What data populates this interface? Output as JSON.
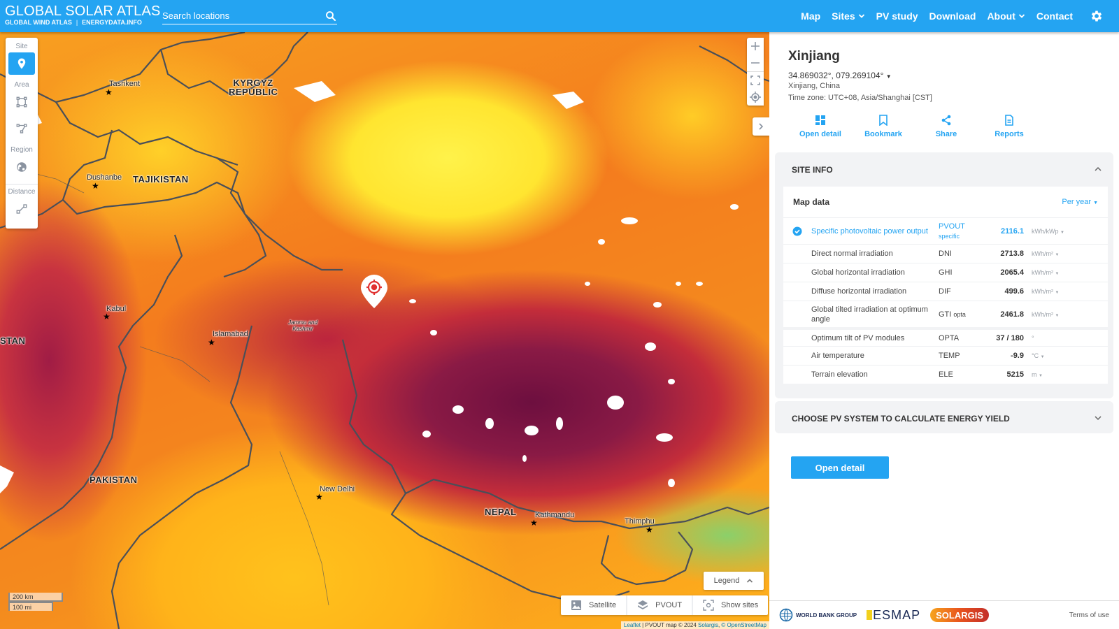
{
  "header": {
    "brand_title": "GLOBAL SOLAR ATLAS",
    "brand_links": [
      "GLOBAL WIND ATLAS",
      "ENERGYDATA.INFO"
    ],
    "search_placeholder": "Search locations",
    "nav": [
      {
        "label": "Map",
        "dropdown": false
      },
      {
        "label": "Sites",
        "dropdown": true
      },
      {
        "label": "PV study",
        "dropdown": false
      },
      {
        "label": "Download",
        "dropdown": false
      },
      {
        "label": "About",
        "dropdown": true
      },
      {
        "label": "Contact",
        "dropdown": false
      }
    ],
    "settings_icon": "gear-icon"
  },
  "toolbox": {
    "site_label": "Site",
    "area_label": "Area",
    "region_label": "Region",
    "distance_label": "Distance"
  },
  "map": {
    "cities": [
      {
        "name": "Tashkent"
      },
      {
        "name": "Dushanbe"
      },
      {
        "name": "Kabul"
      },
      {
        "name": "Islamabad"
      },
      {
        "name": "New Delhi"
      },
      {
        "name": "Kathmandu"
      },
      {
        "name": "Thimphu"
      }
    ],
    "countries": [
      "KYRGYZ REPUBLIC",
      "TAJIKISTAN",
      "PAKISTAN",
      "NEPAL",
      "STAN"
    ],
    "regions": [
      "Jammu and Kashmir"
    ],
    "scale": {
      "km": "200 km",
      "mi": "100 mi"
    },
    "legend_label": "Legend",
    "layers": [
      {
        "label": "Satellite",
        "icon": "image-icon"
      },
      {
        "label": "PVOUT",
        "icon": "layers-icon"
      },
      {
        "label": "Show sites",
        "icon": "scan-icon"
      }
    ],
    "attribution": {
      "leaflet": "Leaflet",
      "text": " | PVOUT map © 2024 ",
      "solargis": "Solargis",
      "osm": "© OpenStreetMap"
    }
  },
  "site": {
    "title": "Xinjiang",
    "coordinates": "34.869032°, 079.269104°",
    "place": "Xinjiang, China",
    "timezone": "Time zone: UTC+08, Asia/Shanghai [CST]",
    "actions": [
      "Open detail",
      "Bookmark",
      "Share",
      "Reports"
    ]
  },
  "site_info": {
    "title": "SITE INFO",
    "map_data_title": "Map data",
    "period": "Per year",
    "rows": [
      {
        "name": "Specific photovoltaic power output",
        "abbr": "PVOUT",
        "abbr_sub": "specific",
        "value": "2116.1",
        "unit": "kWh/kWp",
        "selected": true
      },
      {
        "name": "Direct normal irradiation",
        "abbr": "DNI",
        "abbr_sub": "",
        "value": "2713.8",
        "unit": "kWh/m²"
      },
      {
        "name": "Global horizontal irradiation",
        "abbr": "GHI",
        "abbr_sub": "",
        "value": "2065.4",
        "unit": "kWh/m²"
      },
      {
        "name": "Diffuse horizontal irradiation",
        "abbr": "DIF",
        "abbr_sub": "",
        "value": "499.6",
        "unit": "kWh/m²"
      },
      {
        "name": "Global tilted irradiation at optimum angle",
        "abbr": "GTI",
        "abbr_sub": "opta",
        "value": "2461.8",
        "unit": "kWh/m²"
      },
      {
        "name": "Optimum tilt of PV modules",
        "abbr": "OPTA",
        "abbr_sub": "",
        "value": "37 /  180",
        "unit": "°"
      },
      {
        "name": "Air temperature",
        "abbr": "TEMP",
        "abbr_sub": "",
        "value": "-9.9",
        "unit": "°C"
      },
      {
        "name": "Terrain elevation",
        "abbr": "ELE",
        "abbr_sub": "",
        "value": "5215",
        "unit": "m"
      }
    ]
  },
  "pv_section": {
    "title": "CHOOSE PV SYSTEM TO CALCULATE ENERGY YIELD"
  },
  "open_detail_button": "Open detail",
  "footer": {
    "worldbank": "WORLD BANK GROUP",
    "esmap": "ESMAP",
    "solargis": "SOLARGIS",
    "terms": "Terms of use"
  },
  "colors": {
    "accent": "#24a4f2",
    "panel_bg": "#f2f3f5"
  }
}
